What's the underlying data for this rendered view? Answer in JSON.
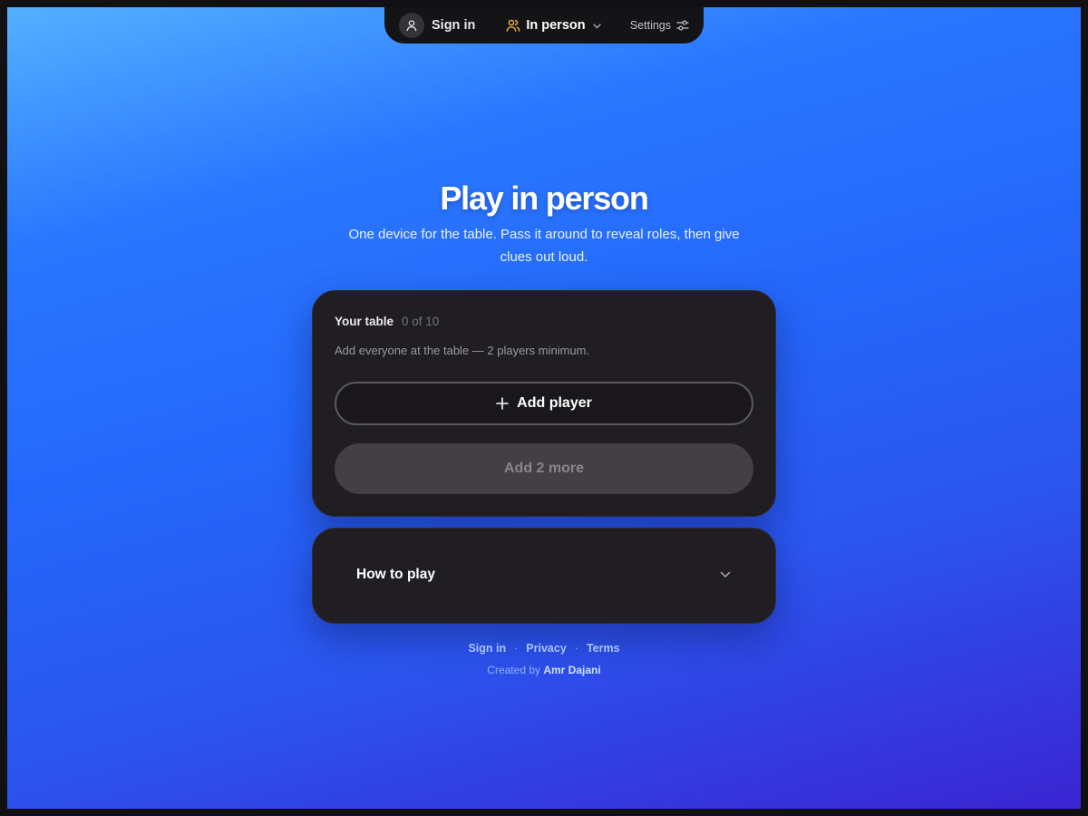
{
  "colors": {
    "background_top": "#55b0ff",
    "background_bottom": "#3a25d2",
    "card": "#201e23",
    "nav": "#141416",
    "accent_people_icon": "#f3b63c"
  },
  "nav": {
    "signin_label": "Sign in",
    "signin_icon": "user-icon",
    "mode_label": "In person",
    "mode_icon": "people-icon",
    "mode_chevron_icon": "chevron-down-icon",
    "settings_label": "Settings",
    "settings_icon": "sliders-icon"
  },
  "hero": {
    "title": "Play in person",
    "subtitle": "One device for the table. Pass it around to reveal roles, then give clues out loud."
  },
  "table_card": {
    "title": "Your table",
    "count": "0 of 10",
    "description": "Add everyone at the table — 2 players minimum.",
    "add_button_label": "Add player",
    "add_button_icon": "plus-icon",
    "continue_button_label": "Add 2 more"
  },
  "howto": {
    "label": "How to play",
    "icon": "chevron-down-icon"
  },
  "footer": {
    "links": [
      "Sign in",
      "Privacy",
      "Terms"
    ],
    "separator": "·",
    "credit_prefix": "Created by",
    "credit_author": "Amr Dajani"
  }
}
